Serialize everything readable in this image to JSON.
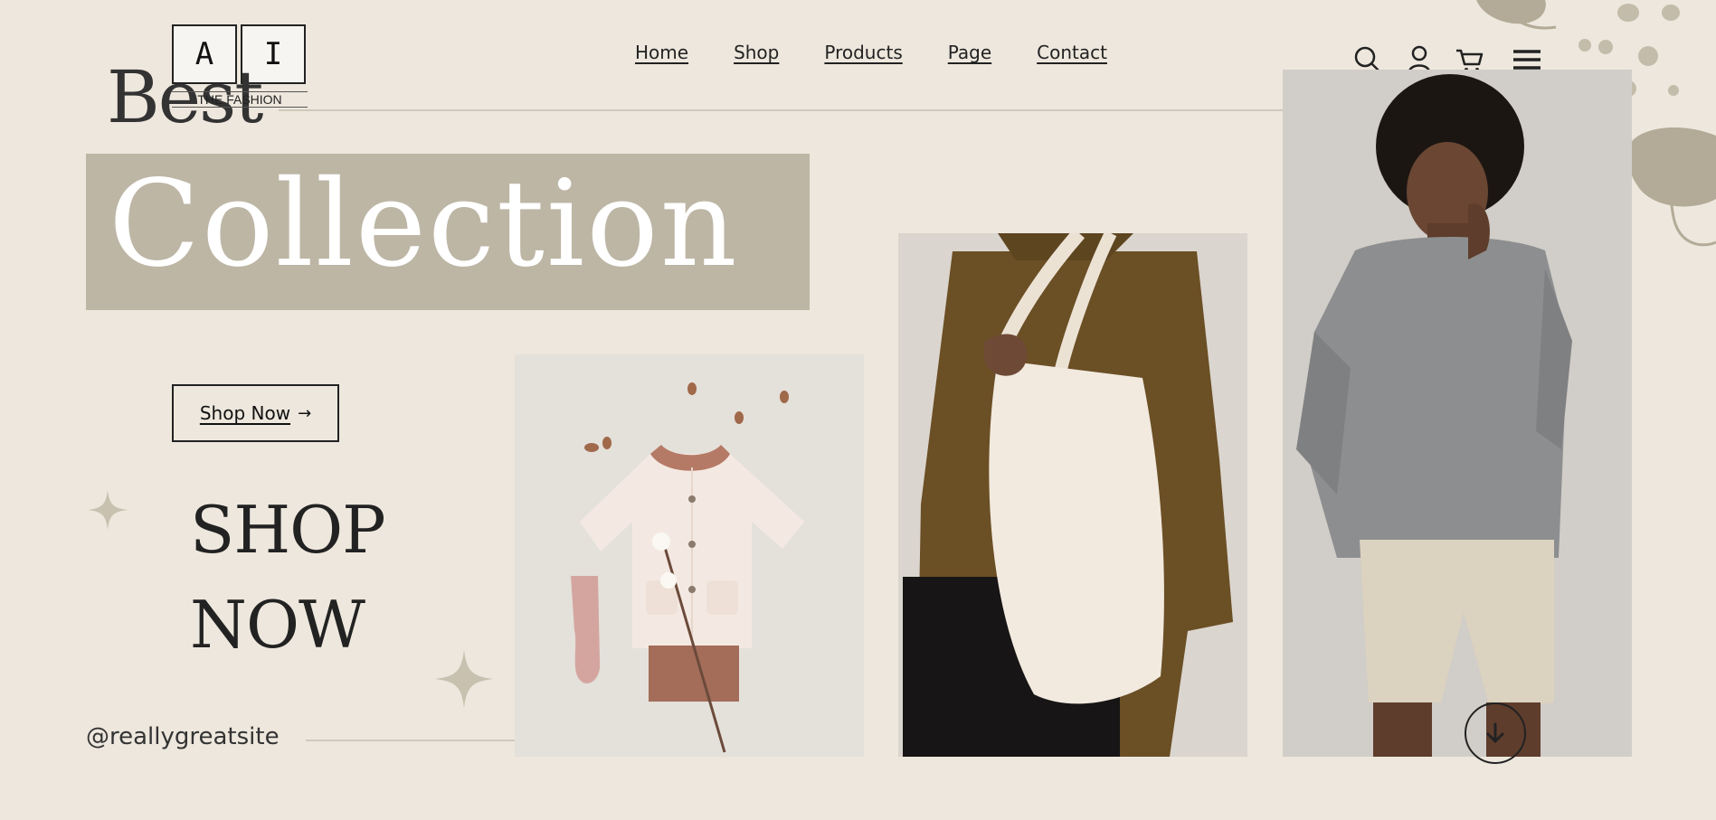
{
  "logo": {
    "letter_left": "A",
    "letter_right": "I",
    "tagline": "THE FASHION"
  },
  "nav": {
    "items": [
      {
        "label": "Home"
      },
      {
        "label": "Shop"
      },
      {
        "label": "Products"
      },
      {
        "label": "Page"
      },
      {
        "label": "Contact"
      }
    ]
  },
  "header_icons": [
    "search-icon",
    "user-icon",
    "cart-icon",
    "menu-icon"
  ],
  "hero": {
    "title_top": "Best",
    "title_main": "Collection",
    "cta_label": "Shop Now",
    "shop_line1": "SHOP",
    "shop_line2": "NOW",
    "handle": "@reallygreatsite"
  },
  "colors": {
    "background": "#ede7dd",
    "band": "#bdb6a5",
    "accent_shape": "#b3ab97",
    "text": "#222222"
  }
}
